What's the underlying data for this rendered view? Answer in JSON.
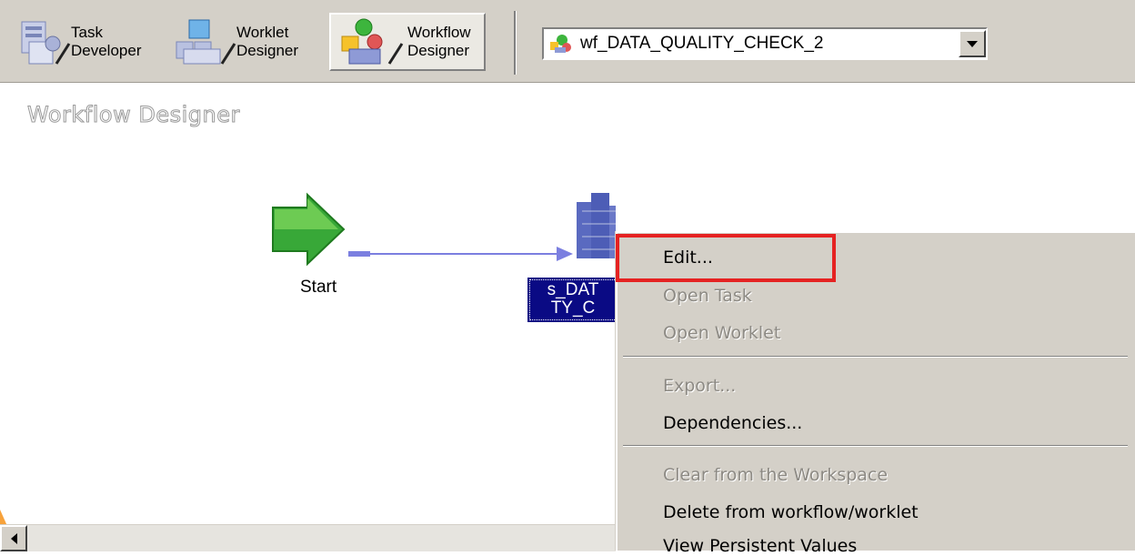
{
  "toolbar": {
    "buttons": [
      {
        "label": "Task\nDeveloper"
      },
      {
        "label": "Worklet\nDesigner"
      },
      {
        "label": "Workflow\nDesigner"
      }
    ],
    "workflow_select": {
      "value": "wf_DATA_QUALITY_CHECK_2"
    }
  },
  "page_title": "Workflow Designer",
  "canvas": {
    "start_label": "Start",
    "session_label": "s_DAT\nTY_C"
  },
  "context_menu": {
    "items": [
      {
        "label": "Edit...",
        "enabled": true
      },
      {
        "label": "Open Task",
        "enabled": false
      },
      {
        "label": "Open Worklet",
        "enabled": false
      },
      {
        "label": "Export...",
        "enabled": false
      },
      {
        "label": "Dependencies...",
        "enabled": true
      },
      {
        "label": "Clear from the Workspace",
        "enabled": false
      },
      {
        "label": "Delete from workflow/worklet",
        "enabled": true
      },
      {
        "label": "View Persistent Values",
        "enabled": true
      }
    ]
  },
  "colors": {
    "highlight": "#e52222",
    "selection": "#0a0a84",
    "watermark": "#f7a23b"
  }
}
